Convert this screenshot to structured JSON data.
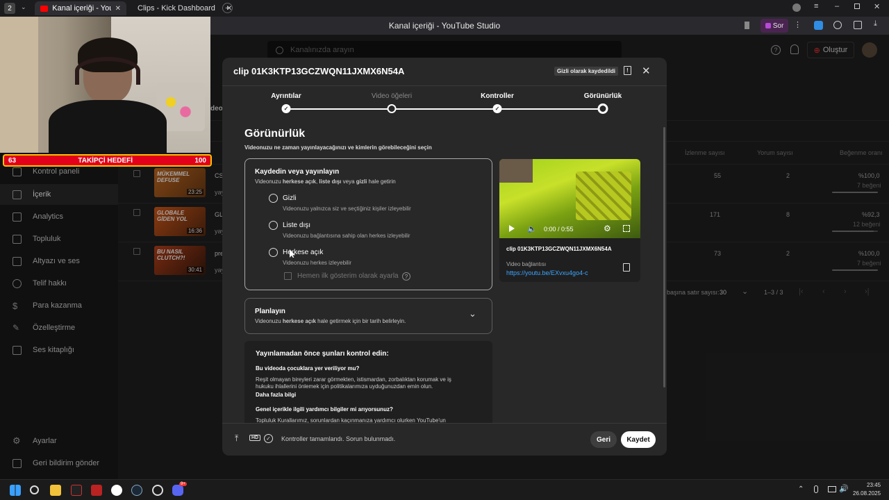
{
  "browser": {
    "workspace_badge": "2",
    "tabs": [
      {
        "label": "Kanal içeriği - YouTube",
        "active": true,
        "favicon_color": "#ff0000"
      },
      {
        "label": "Clips - Kick Dashboard",
        "active": false,
        "favicon_color": "#53fc18"
      }
    ],
    "window_title": "Kanal içeriği - YouTube Studio",
    "sor_button": "Sor"
  },
  "studio": {
    "search_placeholder": "Kanalınızda arayın",
    "create_label": "Oluştur",
    "sidebar": [
      {
        "label": "Kontrol paneli",
        "icon": "dashboard-icon"
      },
      {
        "label": "İçerik",
        "icon": "content-icon",
        "active": true
      },
      {
        "label": "Analytics",
        "icon": "analytics-icon"
      },
      {
        "label": "Topluluk",
        "icon": "community-icon"
      },
      {
        "label": "Altyazı ve ses",
        "icon": "subtitles-icon"
      },
      {
        "label": "Telif hakkı",
        "icon": "copyright-icon"
      },
      {
        "label": "Para kazanma",
        "icon": "dollar-icon"
      },
      {
        "label": "Özelleştirme",
        "icon": "customize-icon"
      },
      {
        "label": "Ses kitaplığı",
        "icon": "audio-library-icon"
      }
    ],
    "sidebar_bottom": [
      {
        "label": "Ayarlar",
        "icon": "gear-icon"
      },
      {
        "label": "Geri bildirim gönder",
        "icon": "feedback-icon"
      }
    ],
    "tab_partial": "deol",
    "columns": [
      "İzlenme sayısı",
      "Yorum sayısı",
      "Beğenme oranı"
    ],
    "rows": [
      {
        "thumb_text": "MÜKEMMEL DEFUSE",
        "duration": "23:25",
        "title_partial": "CS",
        "sub_partial": "yay",
        "views": "55",
        "comments": "2",
        "like_pct": "%100,0",
        "likes": "7 beğeni",
        "like_ratio": 1.0
      },
      {
        "thumb_text": "GLOBALE GİDEN YOL",
        "duration": "16:36",
        "title_partial": "GL",
        "sub_partial": "yay",
        "views": "171",
        "comments": "8",
        "like_pct": "%92,3",
        "likes": "12 beğeni",
        "like_ratio": 0.923
      },
      {
        "thumb_text": "BU NASIL CLUTCH?!",
        "duration": "30:41",
        "title_partial": "pre",
        "sub_partial": "yay",
        "views": "73",
        "comments": "2",
        "like_pct": "%100,0",
        "likes": "7 beğeni",
        "like_ratio": 1.0
      }
    ],
    "pagination": {
      "rows_label": "başına satır sayısı:",
      "rows_value": "30",
      "range": "1–3 / 3"
    }
  },
  "overlay": {
    "follower_current": "63",
    "follower_label": "TAKİPÇİ HEDEFİ",
    "follower_goal": "100"
  },
  "modal": {
    "title": "clip 01K3KTP13GCZWQN11JXMX6N54A",
    "saved_badge": "Gizli olarak kaydedildi",
    "steps": [
      {
        "label": "Ayrıntılar",
        "state": "done"
      },
      {
        "label": "Video öğeleri",
        "state": "dim"
      },
      {
        "label": "Kontroller",
        "state": "done"
      },
      {
        "label": "Görünürlük",
        "state": "current"
      }
    ],
    "section_title": "Görünürlük",
    "section_subtitle": "Videonuzu ne zaman yayınlayacağınızı ve kimlerin görebileceğini seçin",
    "save_publish": {
      "title": "Kaydedin veya yayınlayın",
      "subtitle_pre": "Videonuzu ",
      "subtitle_b1": "herkese açık",
      "subtitle_mid1": ", ",
      "subtitle_b2": "liste dışı",
      "subtitle_mid2": " veya ",
      "subtitle_b3": "gizli",
      "subtitle_post": " hale getirin",
      "options": [
        {
          "label": "Gizli",
          "desc": "Videonuzu yalnızca siz ve seçtiğiniz kişiler izleyebilir"
        },
        {
          "label": "Liste dışı",
          "desc": "Videonuzu bağlantısına sahip olan herkes izleyebilir"
        },
        {
          "label": "Herkese açık",
          "desc": "Videonuzu herkes izleyebilir"
        }
      ],
      "premiere_label": "Hemen ilk gösterim olarak ayarla",
      "help": "?"
    },
    "schedule": {
      "title": "Planlayın",
      "sub_pre": "Videonuzu ",
      "sub_bold": "herkese açık",
      "sub_post": " hale getirmek için bir tarih belirleyin."
    },
    "checklist": {
      "title": "Yayınlamadan önce şunları kontrol edin:",
      "q1": "Bu videoda çocuklara yer veriliyor mu?",
      "t1": "Reşit olmayan bireyleri zarar görmekten, istismardan, zorbalıktan korumak ve iş hukuku ihlallerini önlemek için politikalarımıza uyduğunuzdan emin olun.",
      "link1": "Daha fazla bilgi",
      "q2": "Genel içerikle ilgili yardımcı bilgiler mi arıyorsunuz?",
      "t2": "Topluluk Kurallarımız, sorunlardan kaçınmanıza yardımcı olurken YouTube'un"
    },
    "preview": {
      "time": "0:00 / 0:55",
      "filename": "clip 01K3KTP13GCZWQN11JXMX6N54A",
      "link_label": "Video bağlantısı",
      "link": "https://youtu.be/EXvxu4go4-c"
    },
    "footer": {
      "status": "Kontroller tamamlandı. Sorun bulunmadı.",
      "hd": "HD",
      "back": "Geri",
      "save": "Kaydet"
    }
  },
  "taskbar": {
    "time": "23:45",
    "date": "26.08.2025",
    "badge": "9+"
  }
}
